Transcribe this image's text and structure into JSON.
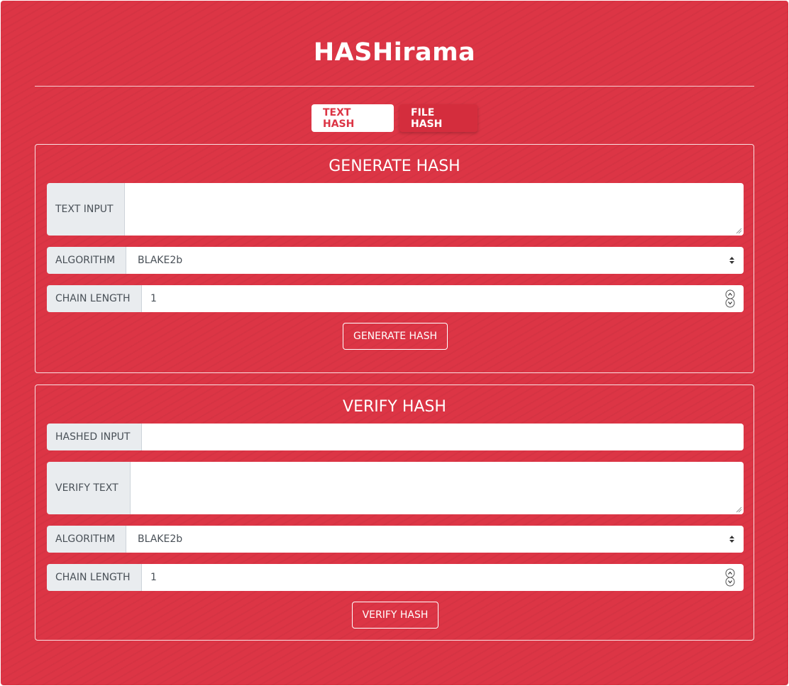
{
  "app": {
    "title": "HASHirama",
    "accent_color": "#dc3545"
  },
  "tabs": [
    {
      "label": "TEXT HASH",
      "active": true
    },
    {
      "label": "FILE HASH",
      "active": false
    }
  ],
  "generate": {
    "title": "GENERATE HASH",
    "text_input_label": "TEXT INPUT",
    "text_input_value": "",
    "algorithm_label": "ALGORITHM",
    "algorithm_value": "BLAKE2b",
    "chain_length_label": "CHAIN LENGTH",
    "chain_length_value": "1",
    "button_label": "GENERATE HASH"
  },
  "verify": {
    "title": "VERIFY HASH",
    "hashed_input_label": "HASHED INPUT",
    "hashed_input_value": "",
    "verify_text_label": "VERIFY TEXT",
    "verify_text_value": "",
    "algorithm_label": "ALGORITHM",
    "algorithm_value": "BLAKE2b",
    "chain_length_label": "CHAIN LENGTH",
    "chain_length_value": "1",
    "button_label": "VERIFY HASH"
  },
  "icons": {
    "select_arrows": "select-arrows-icon",
    "number_spinner": "number-spinner-icon",
    "resize_grip": "resize-grip-icon"
  }
}
